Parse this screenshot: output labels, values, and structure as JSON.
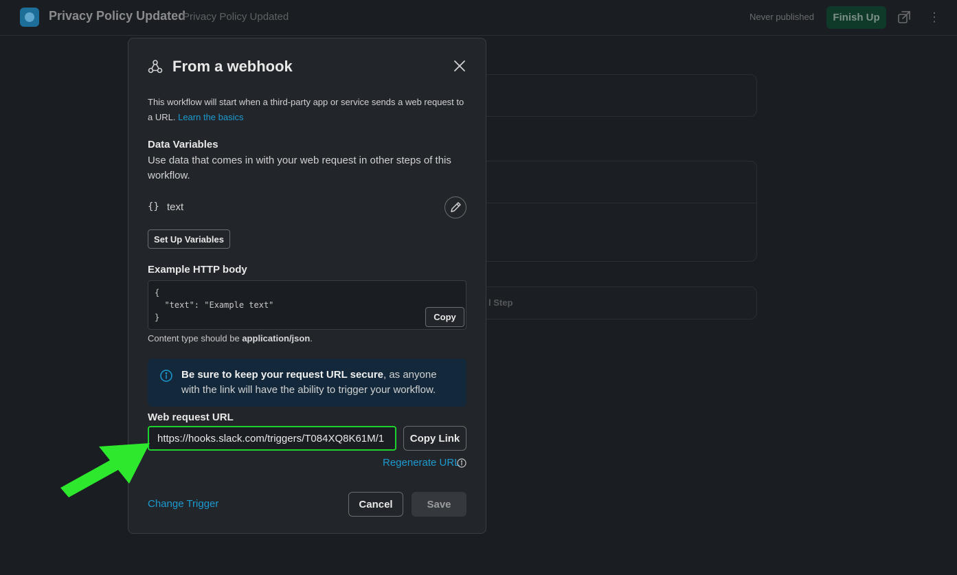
{
  "header": {
    "title": "Privacy Policy Updated",
    "subtitle": "Privacy Policy Updated",
    "status": "Never published",
    "finish_label": "Finish Up"
  },
  "background": {
    "step_text": "l Step"
  },
  "modal": {
    "title": "From a webhook",
    "description": "This workflow will start when a third-party app or service sends a web request to a URL.",
    "learn_link": "Learn the basics",
    "data_vars_title": "Data Variables",
    "data_vars_desc": "Use data that comes in with your web request in other steps of this workflow.",
    "variable_braces": "{}",
    "variable_name": "text",
    "setup_label": "Set Up Variables",
    "example_title": "Example HTTP body",
    "example_code": "{\n  \"text\": \"Example text\"\n}",
    "copy_label": "Copy",
    "content_type_prefix": "Content type should be ",
    "content_type_value": "application/json",
    "content_type_suffix": ".",
    "info_bold": "Be sure to keep your request URL secure",
    "info_rest": ", as anyone with the link will have the ability to trigger your workflow.",
    "url_label": "Web request URL",
    "url_value": "https://hooks.slack.com/triggers/T084XQ8K61M/1",
    "copy_link_label": "Copy Link",
    "regenerate_label": "Regenerate URL",
    "change_trigger_label": "Change Trigger",
    "cancel_label": "Cancel",
    "save_label": "Save"
  },
  "colors": {
    "accent_link": "#1d9bd1",
    "highlight": "#1ed32e",
    "info_bg": "#13293b"
  }
}
